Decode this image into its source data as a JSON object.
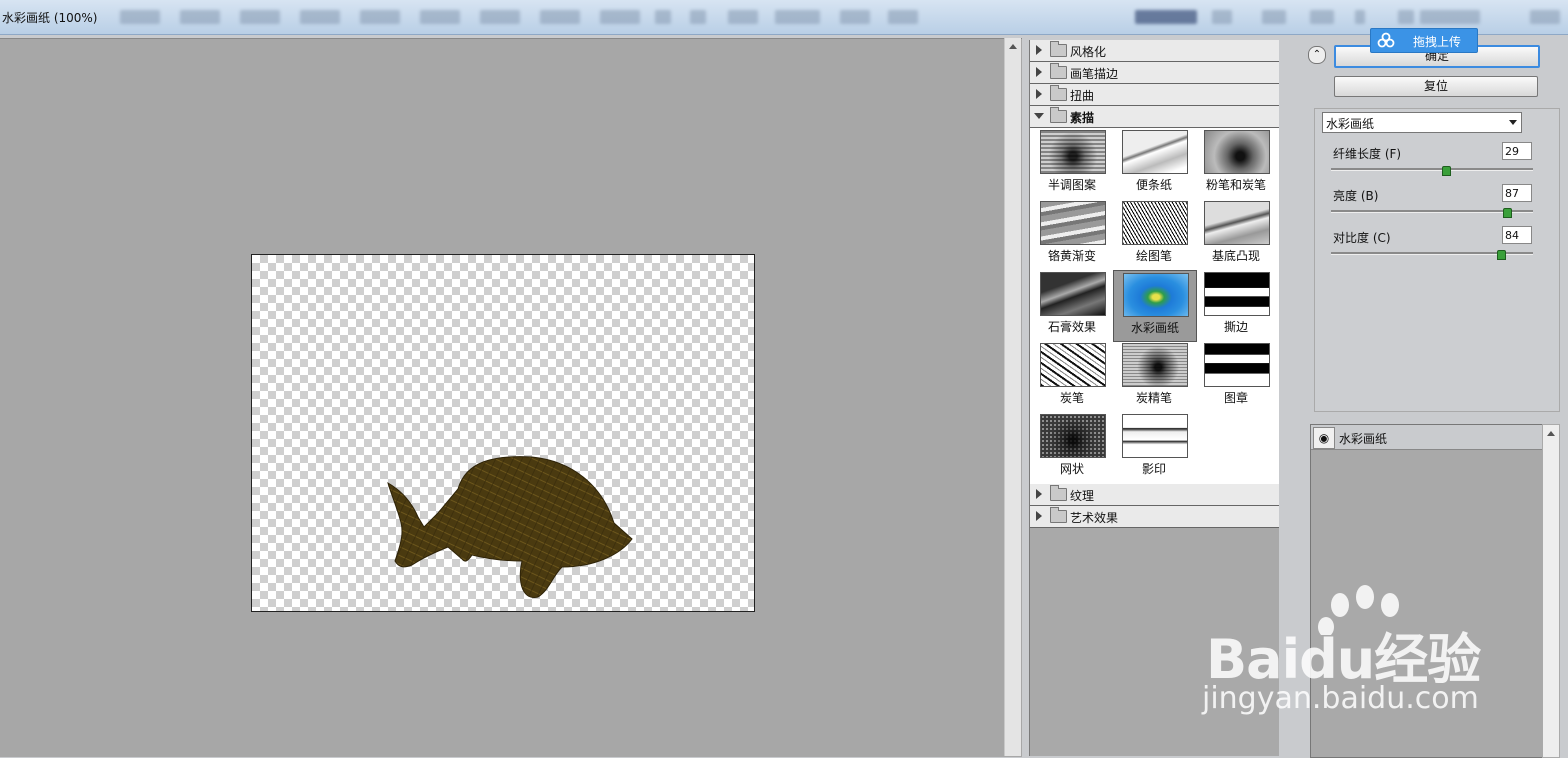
{
  "window": {
    "title": "水彩画纸 (100%)"
  },
  "upload_button": {
    "label": "拖拽上传"
  },
  "filter_gallery": {
    "categories_top": [
      {
        "label": "风格化",
        "expanded": false
      },
      {
        "label": "画笔描边",
        "expanded": false
      },
      {
        "label": "扭曲",
        "expanded": false
      },
      {
        "label": "素描",
        "expanded": true
      }
    ],
    "sketch_filters": [
      {
        "label": "半调图案",
        "icon": "halftone-thumb",
        "selected": false
      },
      {
        "label": "便条纸",
        "icon": "notepaper-thumb",
        "selected": false
      },
      {
        "label": "粉笔和炭笔",
        "icon": "chalk-charcoal-thumb",
        "selected": false
      },
      {
        "label": "铬黄渐变",
        "icon": "chrome-thumb",
        "selected": false
      },
      {
        "label": "绘图笔",
        "icon": "graphic-pen-thumb",
        "selected": false
      },
      {
        "label": "基底凸现",
        "icon": "bas-relief-thumb",
        "selected": false
      },
      {
        "label": "石膏效果",
        "icon": "plaster-thumb",
        "selected": false
      },
      {
        "label": "水彩画纸",
        "icon": "water-paper-thumb",
        "selected": true
      },
      {
        "label": "撕边",
        "icon": "torn-edges-thumb",
        "selected": false
      },
      {
        "label": "炭笔",
        "icon": "charcoal-thumb",
        "selected": false
      },
      {
        "label": "炭精笔",
        "icon": "conte-crayon-thumb",
        "selected": false
      },
      {
        "label": "图章",
        "icon": "stamp-thumb",
        "selected": false
      },
      {
        "label": "网状",
        "icon": "reticulation-thumb",
        "selected": false
      },
      {
        "label": "影印",
        "icon": "photocopy-thumb",
        "selected": false
      }
    ],
    "categories_bottom": [
      {
        "label": "纹理",
        "expanded": false
      },
      {
        "label": "艺术效果",
        "expanded": false
      }
    ]
  },
  "actions": {
    "ok_label": "确定",
    "reset_label": "复位"
  },
  "settings": {
    "filter_select": "水彩画纸",
    "params": [
      {
        "label": "纤维长度 (F)",
        "value": "29",
        "fraction": 0.57
      },
      {
        "label": "亮度 (B)",
        "value": "87",
        "fraction": 0.87
      },
      {
        "label": "对比度 (C)",
        "value": "84",
        "fraction": 0.84
      }
    ]
  },
  "effect_layers": {
    "items": [
      {
        "label": "水彩画纸",
        "visible": true
      }
    ]
  },
  "watermark": {
    "brand": "Baidu经验",
    "url": "jingyan.baidu.com"
  },
  "colors": {
    "accent": "#3c8be0",
    "canvas_bg": "#a7a7a7",
    "fish": "#4a3a10"
  }
}
